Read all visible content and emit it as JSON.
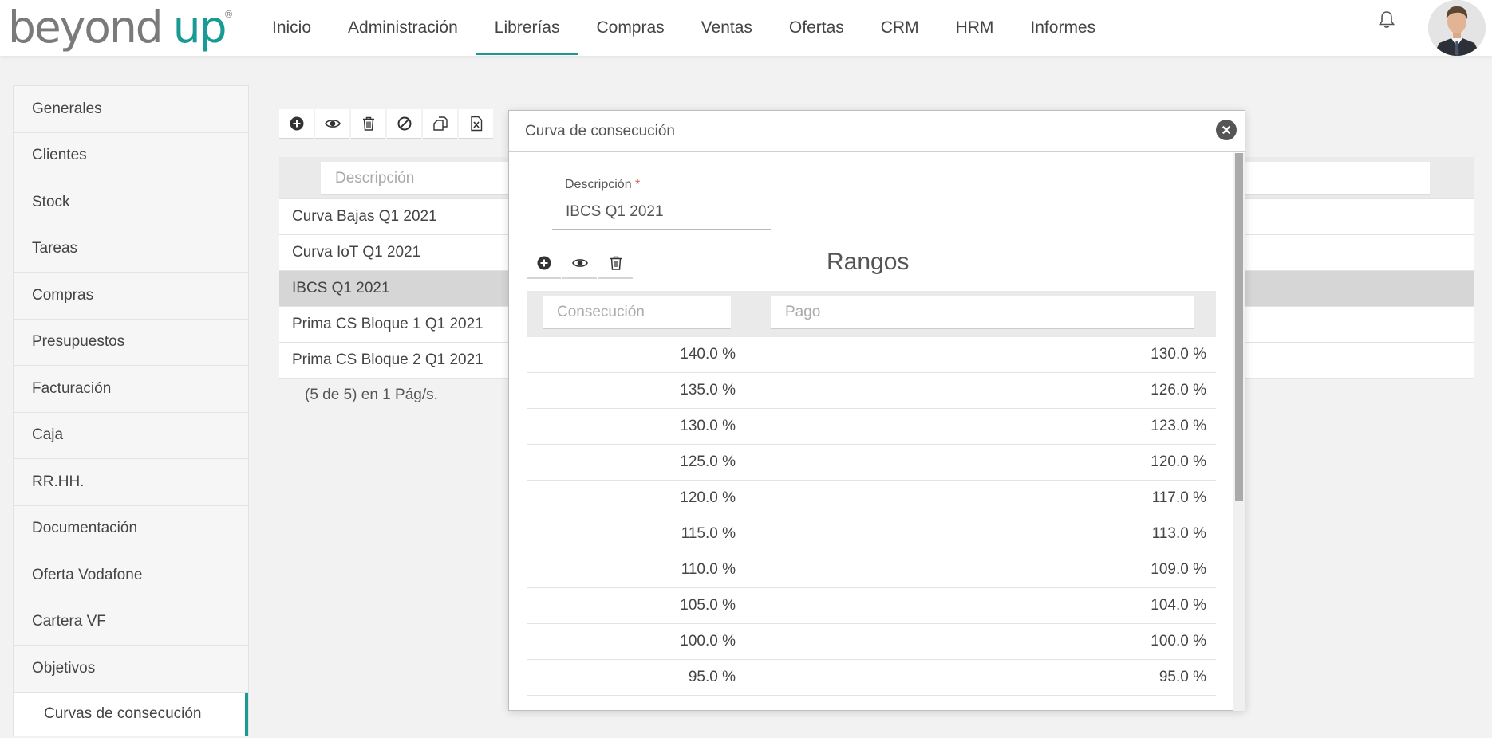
{
  "brand": {
    "word1": "beyond",
    "word2": "up",
    "reg": "®"
  },
  "nav": {
    "items": [
      "Inicio",
      "Administración",
      "Librerías",
      "Compras",
      "Ventas",
      "Ofertas",
      "CRM",
      "HRM",
      "Informes"
    ],
    "active": "Librerías"
  },
  "sidebar": {
    "items": [
      "Generales",
      "Clientes",
      "Stock",
      "Tareas",
      "Compras",
      "Presupuestos",
      "Facturación",
      "Caja",
      "RR.HH.",
      "Documentación",
      "Oferta Vodafone",
      "Cartera VF",
      "Objetivos"
    ],
    "sub_item": "Curvas de consecución"
  },
  "list": {
    "filter_placeholder": "Descripción",
    "rows": [
      "Curva Bajas Q1 2021",
      "Curva IoT Q1 2021",
      "IBCS Q1 2021",
      "Prima CS Bloque 1 Q1 2021",
      "Prima CS Bloque 2 Q1 2021"
    ],
    "selected": "IBCS Q1 2021",
    "pager": "(5 de 5) en 1 Pág/s."
  },
  "modal": {
    "title": "Curva de consecución",
    "field_label": "Descripción",
    "required_mark": "*",
    "field_value": "IBCS Q1 2021",
    "section_title": "Rangos",
    "col1_placeholder": "Consecución",
    "col2_placeholder": "Pago",
    "ranges": [
      {
        "consecucion": "140.0 %",
        "pago": "130.0 %"
      },
      {
        "consecucion": "135.0 %",
        "pago": "126.0 %"
      },
      {
        "consecucion": "130.0 %",
        "pago": "123.0 %"
      },
      {
        "consecucion": "125.0 %",
        "pago": "120.0 %"
      },
      {
        "consecucion": "120.0 %",
        "pago": "117.0 %"
      },
      {
        "consecucion": "115.0 %",
        "pago": "113.0 %"
      },
      {
        "consecucion": "110.0 %",
        "pago": "109.0 %"
      },
      {
        "consecucion": "105.0 %",
        "pago": "104.0 %"
      },
      {
        "consecucion": "100.0 %",
        "pago": "100.0 %"
      },
      {
        "consecucion": "95.0 %",
        "pago": "95.0 %"
      }
    ]
  },
  "colors": {
    "accent": "#1a9a94",
    "selected_row": "#d6d6d6"
  }
}
